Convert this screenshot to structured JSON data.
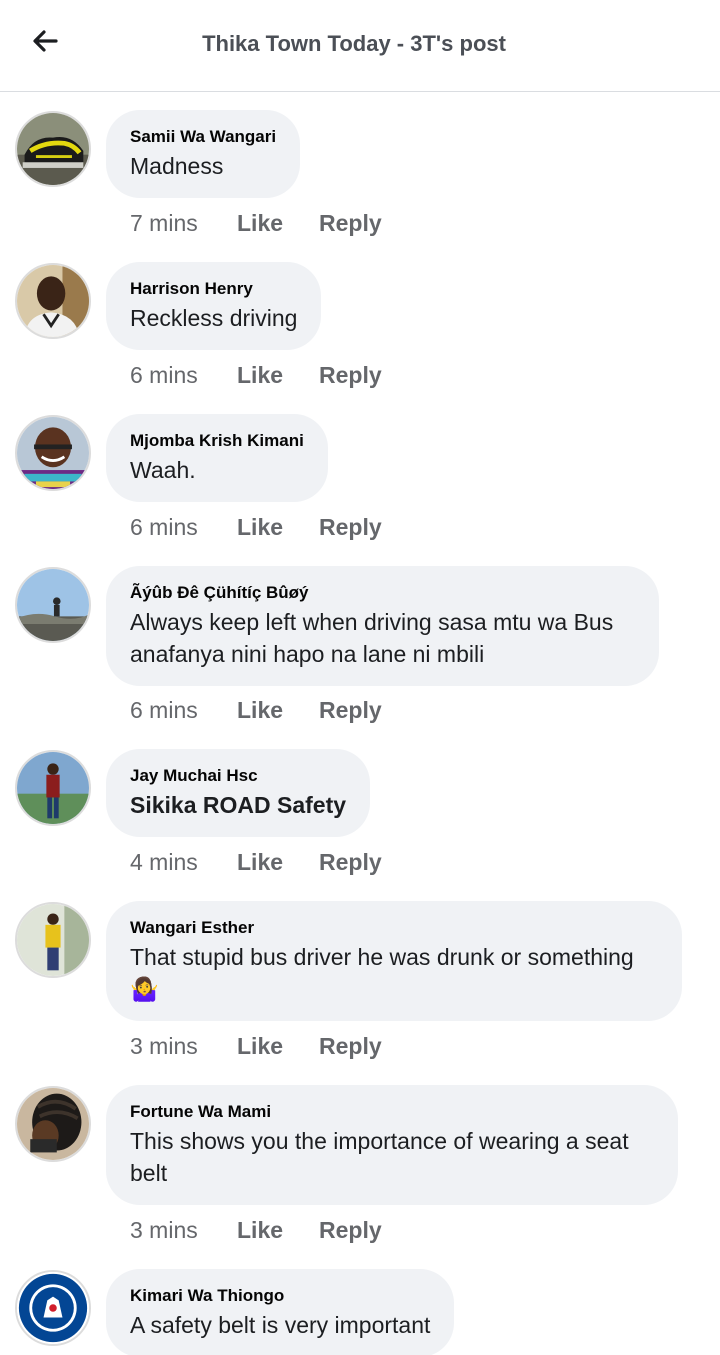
{
  "header": {
    "title": "Thika Town Today - 3T's post",
    "back_icon": "arrow-left-icon"
  },
  "actions": {
    "like": "Like",
    "reply": "Reply"
  },
  "comments": [
    {
      "author": "Samii Wa Wangari",
      "text": "Madness",
      "time": "7 mins",
      "avatar": "sneaker-avatar"
    },
    {
      "author": "Harrison Henry",
      "text": "Reckless driving",
      "time": "6 mins",
      "avatar": "man-portrait-avatar"
    },
    {
      "author": "Mjomba Krish Kimani",
      "text": "Waah.",
      "time": "6 mins",
      "avatar": "man-smiling-avatar"
    },
    {
      "author": "Ãýûb Ðê Çühítíç Bûøý",
      "text": "Always keep left when driving sasa mtu wa Bus anafanya nini hapo na lane ni mbili",
      "time": "6 mins",
      "avatar": "sky-landscape-avatar"
    },
    {
      "author": "Jay Muchai Hsc",
      "text": "Sikika ROAD Safety",
      "time": "4 mins",
      "avatar": "standing-man-avatar"
    },
    {
      "author": "Wangari Esther",
      "text": "That stupid bus driver he was drunk or something 🤷‍♀️",
      "time": "3 mins",
      "avatar": "woman-yellow-avatar"
    },
    {
      "author": "Fortune Wa Mami",
      "text": "This shows you the importance of wearing a seat belt",
      "time": "3 mins",
      "avatar": "braids-portrait-avatar"
    },
    {
      "author": "Kimari Wa Thiongo",
      "text": "A safety belt is very important",
      "time": "",
      "avatar": "chelsea-crest-avatar"
    }
  ]
}
